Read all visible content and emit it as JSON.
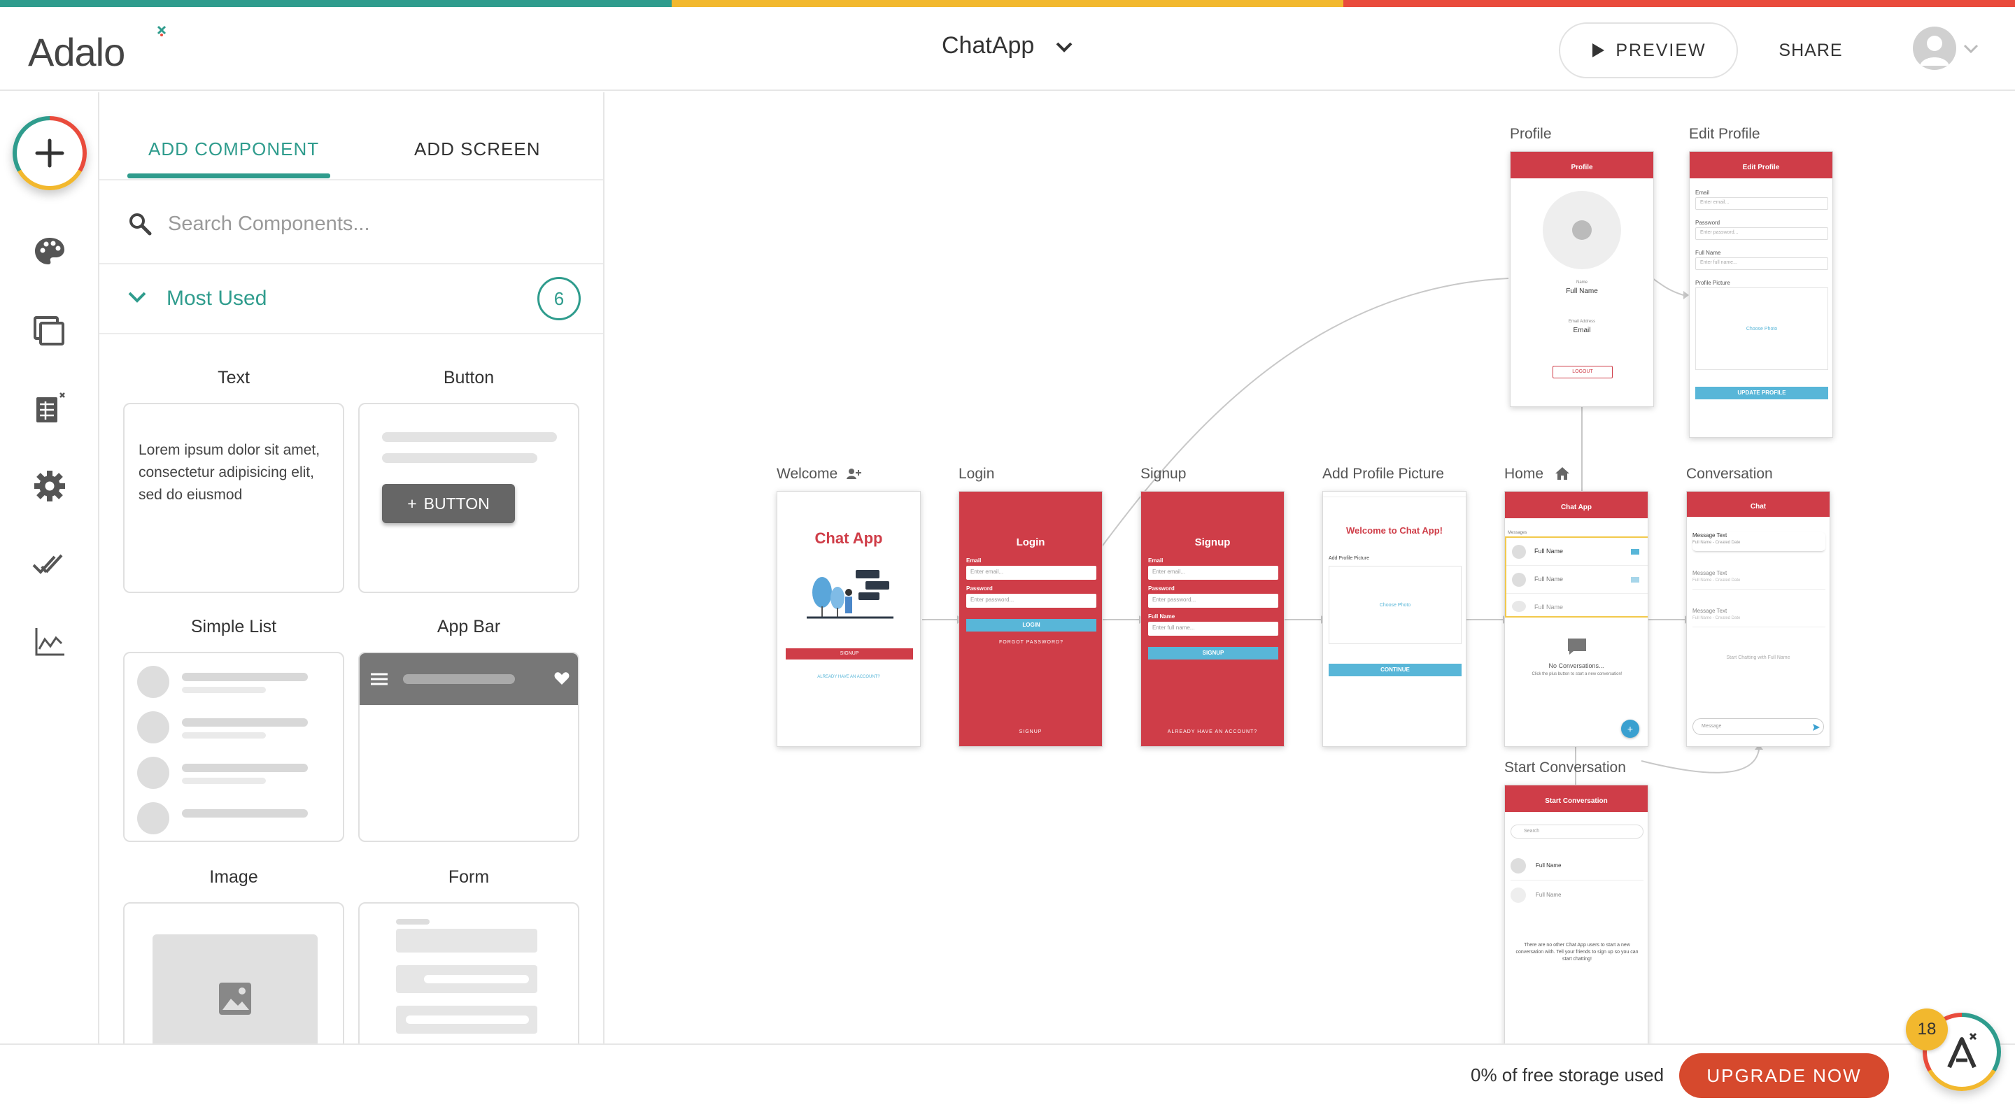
{
  "brand": {
    "logo_text": "Adalo",
    "stripe_colors": [
      "#2f9c8d",
      "#f2b82e",
      "#e94b3c"
    ],
    "accent": "#2f9c8d",
    "screen_red": "#cf3d48"
  },
  "header": {
    "app_name": "ChatApp",
    "preview_label": "PREVIEW",
    "share_label": "SHARE"
  },
  "sidebar": {
    "icons": [
      "add-icon",
      "palette-icon",
      "screens-icon",
      "database-icon",
      "gear-icon",
      "checkmarks-icon",
      "analytics-icon"
    ]
  },
  "panel": {
    "tabs": [
      {
        "label": "ADD COMPONENT",
        "active": true
      },
      {
        "label": "ADD SCREEN",
        "active": false
      }
    ],
    "search_placeholder": "Search Components...",
    "section": {
      "title": "Most Used",
      "count": "6"
    },
    "components": [
      {
        "label": "Text",
        "preview_text": "Lorem ipsum dolor sit amet, consectetur adipisicing elit, sed do eiusmod"
      },
      {
        "label": "Button",
        "preview_text": "BUTTON"
      },
      {
        "label": "Simple List"
      },
      {
        "label": "App Bar"
      },
      {
        "label": "Image"
      },
      {
        "label": "Form"
      }
    ]
  },
  "screens": {
    "welcome": {
      "label": "Welcome",
      "title": "Chat App",
      "signup": "SIGNUP",
      "already": "ALREADY HAVE AN ACCOUNT?"
    },
    "login": {
      "label": "Login",
      "title": "Login",
      "email_label": "Email",
      "email_ph": "Enter email...",
      "password_label": "Password",
      "password_ph": "Enter password...",
      "button": "LOGIN",
      "forgot": "FORGOT PASSWORD?",
      "footer": "SIGNUP"
    },
    "signup": {
      "label": "Signup",
      "title": "Signup",
      "email_label": "Email",
      "email_ph": "Enter email...",
      "password_label": "Password",
      "password_ph": "Enter password...",
      "name_label": "Full Name",
      "name_ph": "Enter full name...",
      "button": "SIGNUP",
      "footer": "ALREADY HAVE AN ACCOUNT?"
    },
    "add_profile_picture": {
      "label": "Add Profile Picture",
      "title": "Welcome to Chat App!",
      "sub": "Add Profile Picture",
      "choose": "Choose Photo",
      "button": "CONTINUE"
    },
    "home": {
      "label": "Home",
      "bar_title": "Chat App",
      "messages": "Messages",
      "items": [
        "Full Name",
        "Full Name",
        "Full Name"
      ],
      "empty_title": "No Conversations...",
      "empty_sub": "Click the plus button to start a new conversation!"
    },
    "conversation": {
      "label": "Conversation",
      "bar_title": "Chat",
      "rows": [
        {
          "text": "Message Text",
          "meta": "Full Name - Created Date"
        },
        {
          "text": "Message Text",
          "meta": "Full Name - Created Date"
        },
        {
          "text": "Message Text",
          "meta": "Full Name - Created Date"
        }
      ],
      "empty": "Start Chatting with Full Name",
      "input_ph": "Message"
    },
    "profile": {
      "label": "Profile",
      "bar_title": "Profile",
      "name_label": "Name",
      "name": "Full Name",
      "email_label": "Email Address",
      "email": "Email",
      "logout": "LOGOUT"
    },
    "edit_profile": {
      "label": "Edit Profile",
      "bar_title": "Edit Profile",
      "email_label": "Email",
      "email_ph": "Enter email...",
      "password_label": "Password",
      "password_ph": "Enter password...",
      "name_label": "Full Name",
      "name_ph": "Enter full name...",
      "picture_label": "Profile Picture",
      "choose": "Choose Photo",
      "button": "UPDATE PROFILE"
    },
    "start_conversation": {
      "label": "Start Conversation",
      "bar_title": "Start Conversation",
      "search_ph": "Search",
      "items": [
        "Full Name",
        "Full Name"
      ],
      "note": "There are no other Chat App users to start a new conversation with. Tell your friends to sign up so you can start chatting!"
    }
  },
  "footer": {
    "storage_text": "0% of free storage used",
    "upgrade_label": "UPGRADE NOW",
    "notifications": "18"
  }
}
